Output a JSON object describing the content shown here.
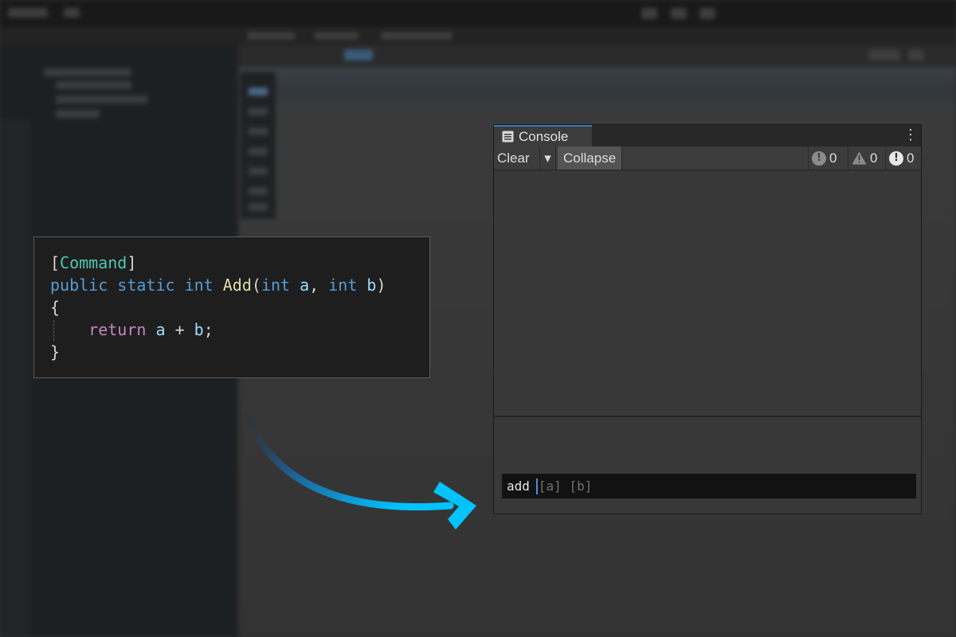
{
  "code": {
    "line1": {
      "open": "[",
      "attr": "Command",
      "close": "]"
    },
    "line2": {
      "kw_public": "public",
      "kw_static": "static",
      "kw_int": "int",
      "fn_name": "Add",
      "paren_open": "(",
      "p1_type": "int",
      "p1_name": "a",
      "comma": ",",
      "p2_type": "int",
      "p2_name": "b",
      "paren_close": ")"
    },
    "line3": "{",
    "line4": {
      "kw_return": "return",
      "a": "a",
      "plus": "+",
      "b": "b",
      "semi": ";"
    },
    "line5": "}"
  },
  "console": {
    "tab_label": "Console",
    "menu_glyph": "⋮",
    "clear_label": "Clear",
    "dropdown_glyph": "▾",
    "collapse_label": "Collapse",
    "log_count": "0",
    "warning_count": "0",
    "error_count": "0",
    "input_text": "add",
    "input_hint": "[a] [b]"
  },
  "colors": {
    "accent": "#3a79bb",
    "arrow_start": "#1b3a5c",
    "arrow_end": "#00c3ff"
  }
}
